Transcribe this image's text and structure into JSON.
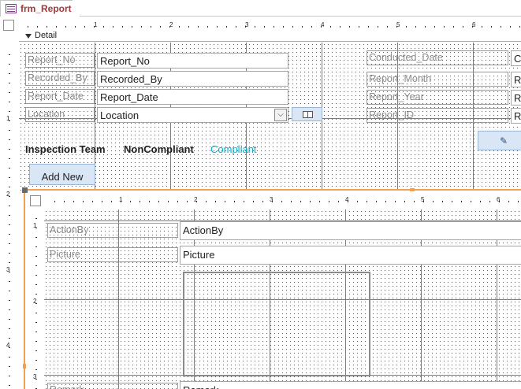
{
  "tab": {
    "title": "frm_Report"
  },
  "section": {
    "detail_label": "Detail"
  },
  "ruler_top": [
    "1",
    "2",
    "3",
    "4",
    "5",
    "6"
  ],
  "ruler_left": [
    "1",
    "2",
    "3",
    "4"
  ],
  "form": {
    "left_fields": [
      {
        "label": "Report_No",
        "value": "Report_No"
      },
      {
        "label": "Recorded_By",
        "value": "Recorded_By"
      },
      {
        "label": "Report_Date",
        "value": "Report_Date"
      },
      {
        "label": "Location",
        "value": "Location"
      }
    ],
    "right_fields": [
      {
        "label": "Conducted_Date",
        "value": "Co"
      },
      {
        "label": "Report_Month",
        "value": "Re"
      },
      {
        "label": "Report_Year",
        "value": "Re"
      },
      {
        "label": "Report_ID",
        "value": "Re"
      }
    ],
    "team_labels": {
      "inspection": "Inspection Team",
      "noncompliant": "NonCompliant",
      "compliant": "Compliant"
    },
    "add_new_label": "Add New",
    "accent_color": "#00b0d0"
  },
  "subform": {
    "ruler_top": [
      "1",
      "2",
      "3",
      "4",
      "5",
      "6"
    ],
    "ruler_left": [
      "1",
      "2",
      "3"
    ],
    "fields": [
      {
        "label": "ActionBy",
        "value": "ActionBy"
      },
      {
        "label": "Picture",
        "value": "Picture"
      },
      {
        "label": "Remark",
        "value": "Remark"
      }
    ],
    "border_color": "#f0a050"
  }
}
